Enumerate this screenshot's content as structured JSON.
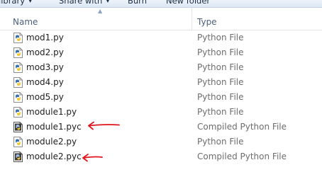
{
  "toolbar": {
    "library_label": "library",
    "share_label": "Share with",
    "burn_label": "Burn",
    "new_folder_label": "New folder"
  },
  "columns": {
    "name": "Name",
    "type": "Type"
  },
  "files": [
    {
      "name": "mod1.py",
      "type": "Python File",
      "icon": "python-file-icon"
    },
    {
      "name": "mod2.py",
      "type": "Python File",
      "icon": "python-file-icon"
    },
    {
      "name": "mod3.py",
      "type": "Python File",
      "icon": "python-file-icon"
    },
    {
      "name": "mod4.py",
      "type": "Python File",
      "icon": "python-file-icon"
    },
    {
      "name": "mod5.py",
      "type": "Python File",
      "icon": "python-file-icon"
    },
    {
      "name": "module1.py",
      "type": "Python File",
      "icon": "python-file-icon"
    },
    {
      "name": "module1.pyc",
      "type": "Compiled Python File",
      "icon": "compiled-python-file-icon",
      "annotated": true
    },
    {
      "name": "module2.py",
      "type": "Python File",
      "icon": "python-file-icon"
    },
    {
      "name": "module2.pyc",
      "type": "Compiled Python File",
      "icon": "compiled-python-file-icon",
      "annotated": true
    }
  ],
  "colors": {
    "annotation": "#e0141e",
    "header_text": "#4c607a",
    "type_text": "#6d6d6d"
  }
}
